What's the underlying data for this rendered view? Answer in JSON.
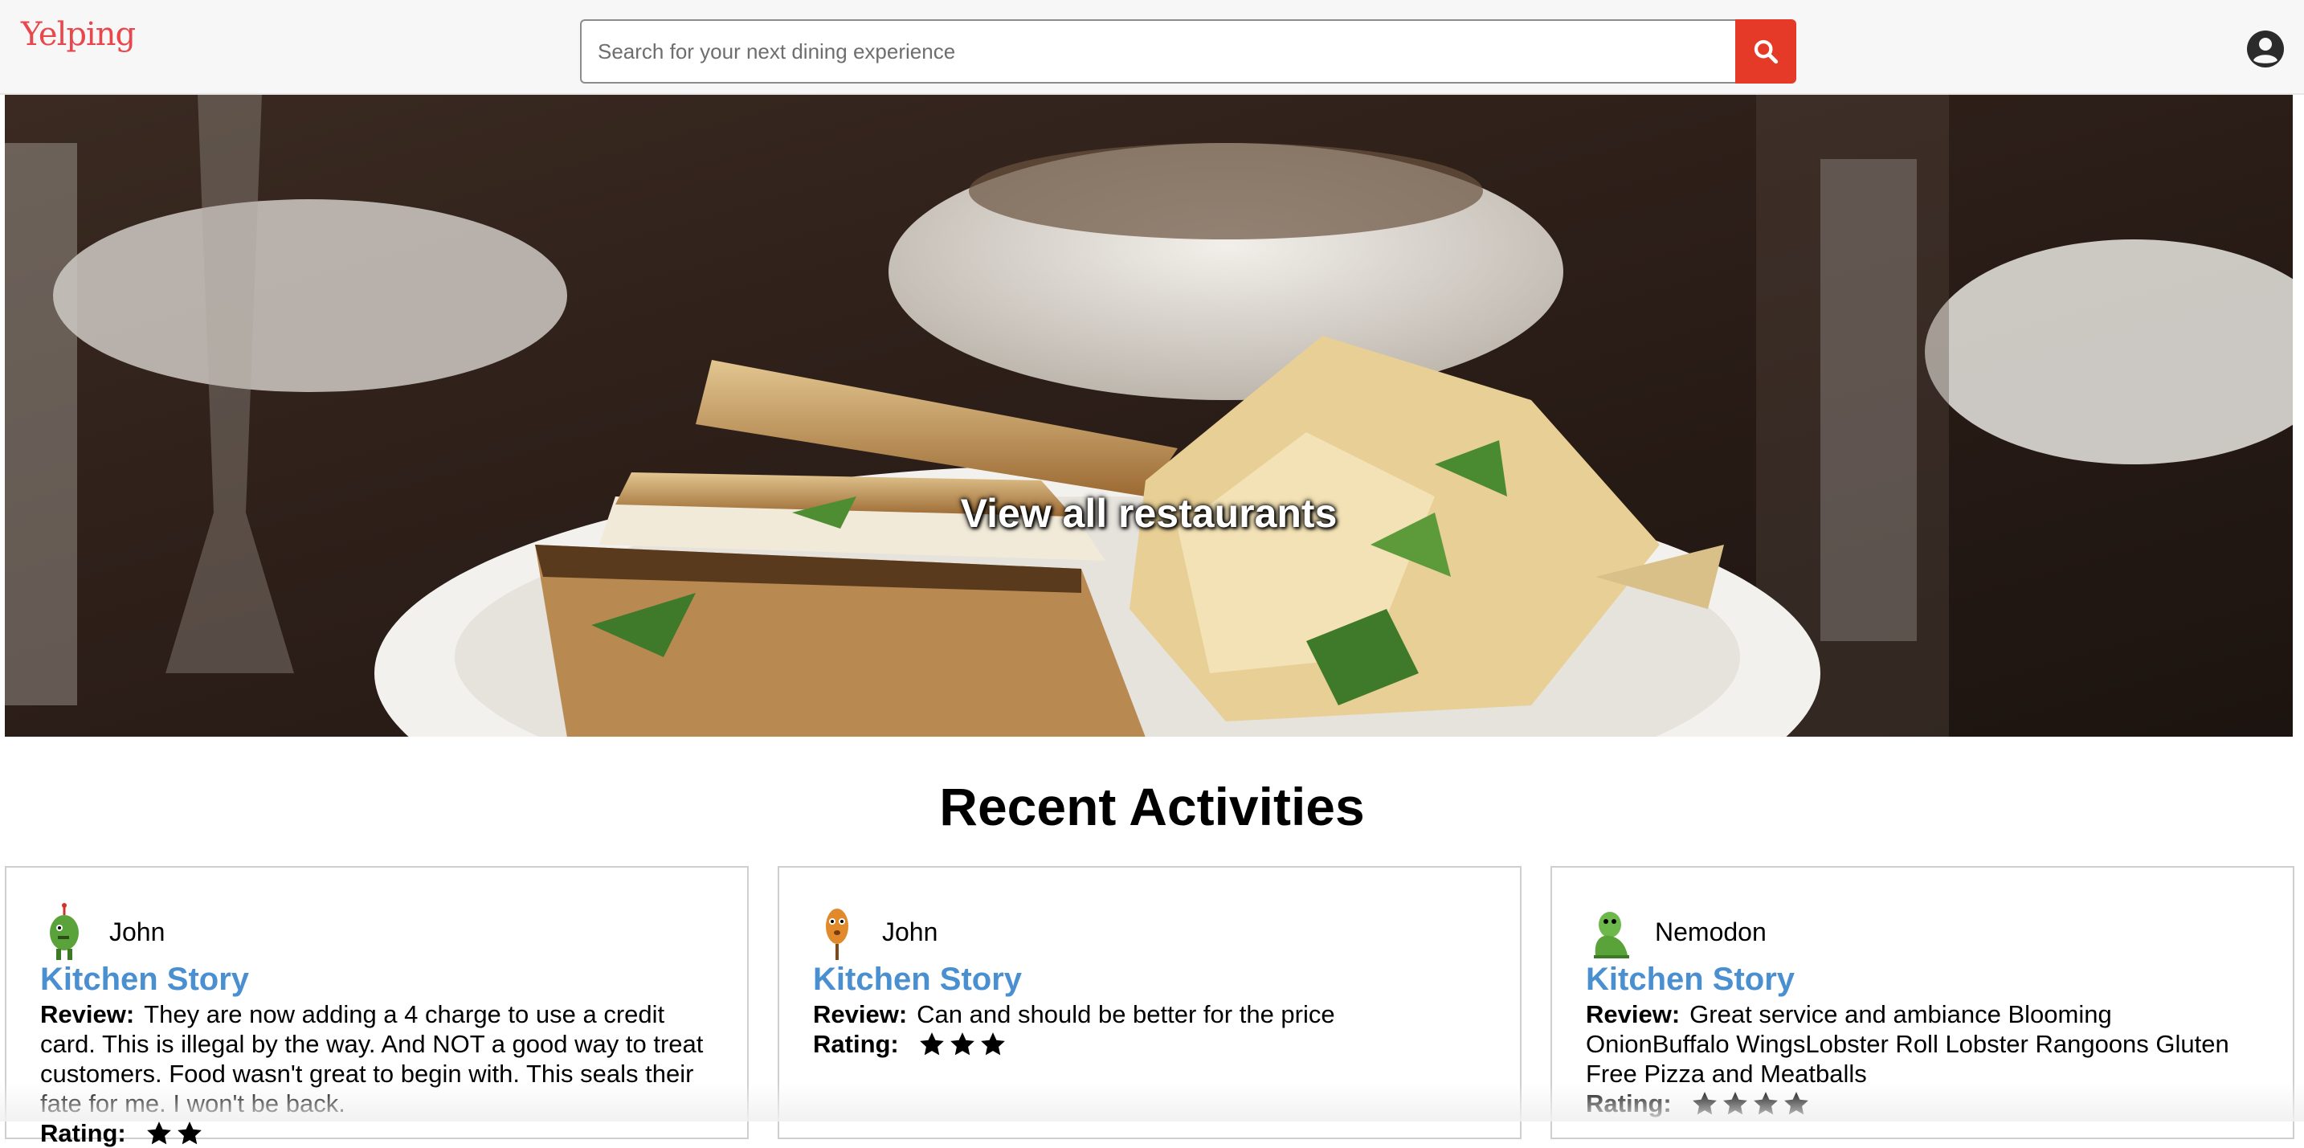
{
  "header": {
    "logo": "Yelping",
    "search": {
      "placeholder": "Search for your next dining experience",
      "value": ""
    }
  },
  "hero": {
    "link": "View all restaurants"
  },
  "section": {
    "title": "Recent Activities"
  },
  "labels": {
    "review": "Review:",
    "rating": "Rating:"
  },
  "activities": [
    {
      "user": "John",
      "restaurant": "Kitchen Story",
      "review": "They are now adding a 4 charge to use a credit card. This is illegal by the way. And NOT a good way to treat customers. Food wasn't great to begin with. This seals their fate for me. I won't be back.",
      "rating": 2,
      "avatar": "green-monster-avatar"
    },
    {
      "user": "John",
      "restaurant": "Kitchen Story",
      "review": "Can and should be better for the price",
      "rating": 3,
      "avatar": "orange-monster-avatar"
    },
    {
      "user": "Nemodon",
      "restaurant": "Kitchen Story",
      "review": "Great service and ambiance Blooming OnionBuffalo WingsLobster Roll Lobster Rangoons Gluten Free Pizza and Meatballs",
      "rating": 4,
      "avatar": "green-dinosaur-avatar"
    }
  ],
  "colors": {
    "brand": "#e8474c",
    "searchButton": "#e53a28",
    "link": "#4a90d0"
  }
}
